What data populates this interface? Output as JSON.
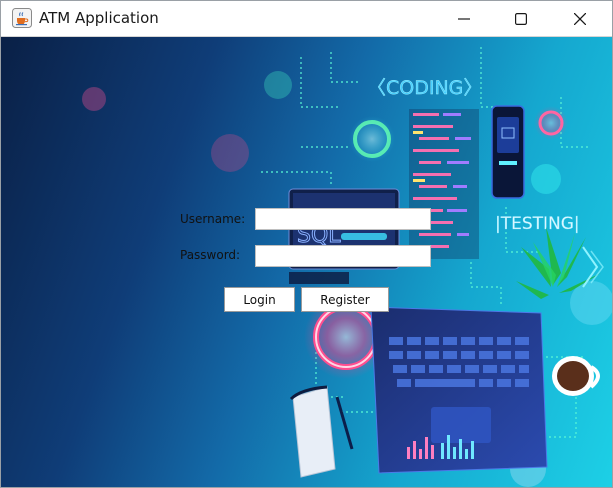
{
  "window": {
    "title": "ATM Application",
    "icon": "java-cup-icon",
    "controls": [
      "minimize-icon",
      "maximize-icon",
      "close-icon"
    ]
  },
  "background": {
    "banner_coding": "〈CODING〉",
    "banner_testing": "|TESTING|",
    "monitor_text": "SQL"
  },
  "login_form": {
    "username_label": "Username:",
    "username_value": "",
    "password_label": "Password:",
    "password_value": "",
    "login_button": "Login",
    "register_button": "Register"
  }
}
